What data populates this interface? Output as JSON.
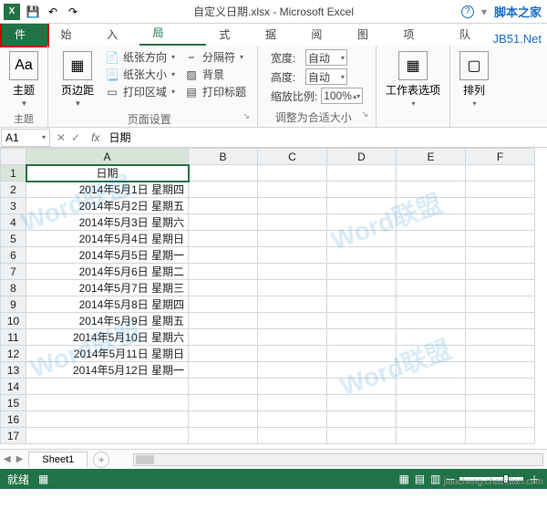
{
  "title": "自定义日期.xlsx - Microsoft Excel",
  "brand_top": "脚本之家",
  "brand_sub": "JB51.Net",
  "tabs": {
    "file": "文件",
    "home": "开始",
    "insert": "插入",
    "layout": "页面布局",
    "formulas": "公式",
    "data": "数据",
    "review": "审阅",
    "view": "视图",
    "addins": "加载项",
    "team": "团队"
  },
  "ribbon": {
    "theme": {
      "btn": "主题",
      "label": "主题"
    },
    "margin": {
      "btn": "页边距"
    },
    "pagesetup": {
      "orientation": "纸张方向",
      "breaks": "分隔符",
      "size": "纸张大小",
      "background": "背景",
      "printarea": "打印区域",
      "printtitles": "打印标题",
      "label": "页面设置"
    },
    "scale": {
      "width": "宽度:",
      "width_val": "自动",
      "height": "高度:",
      "height_val": "自动",
      "scale": "缩放比例:",
      "scale_val": "100%",
      "label": "调整为合适大小"
    },
    "sheetopt": {
      "btn": "工作表选项"
    },
    "arrange": {
      "btn": "排列"
    }
  },
  "namebox": "A1",
  "formula_value": "日期",
  "columns": [
    "A",
    "B",
    "C",
    "D",
    "E",
    "F"
  ],
  "rows": [
    {
      "n": 1,
      "a": "日期"
    },
    {
      "n": 2,
      "a": "2014年5月1日 星期四"
    },
    {
      "n": 3,
      "a": "2014年5月2日 星期五"
    },
    {
      "n": 4,
      "a": "2014年5月3日 星期六"
    },
    {
      "n": 5,
      "a": "2014年5月4日 星期日"
    },
    {
      "n": 6,
      "a": "2014年5月5日 星期一"
    },
    {
      "n": 7,
      "a": "2014年5月6日 星期二"
    },
    {
      "n": 8,
      "a": "2014年5月7日 星期三"
    },
    {
      "n": 9,
      "a": "2014年5月8日 星期四"
    },
    {
      "n": 10,
      "a": "2014年5月9日 星期五"
    },
    {
      "n": 11,
      "a": "2014年5月10日 星期六"
    },
    {
      "n": 12,
      "a": "2014年5月11日 星期日"
    },
    {
      "n": 13,
      "a": "2014年5月12日 星期一"
    },
    {
      "n": 14,
      "a": ""
    },
    {
      "n": 15,
      "a": ""
    },
    {
      "n": 16,
      "a": ""
    },
    {
      "n": 17,
      "a": ""
    }
  ],
  "sheet_tab": "Sheet1",
  "status": "就绪",
  "corner": "jiaocheng.chazidian.com"
}
